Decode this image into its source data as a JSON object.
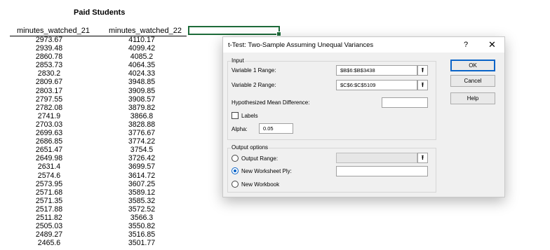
{
  "spreadsheet": {
    "title": "Paid Students",
    "col1_header": "minutes_watched_21",
    "col2_header": "minutes_watched_22",
    "col1_values": [
      "2973.67",
      "2939.48",
      "2860.78",
      "2853.73",
      "2830.2",
      "2809.67",
      "2803.17",
      "2797.55",
      "2782.08",
      "2741.9",
      "2703.03",
      "2699.63",
      "2686.85",
      "2651.47",
      "2649.98",
      "2631.4",
      "2574.6",
      "2573.95",
      "2571.68",
      "2571.35",
      "2517.88",
      "2511.82",
      "2505.03",
      "2489.27",
      "2465.6"
    ],
    "col2_values": [
      "4110.17",
      "4099.42",
      "4085.2",
      "4064.35",
      "4024.33",
      "3948.85",
      "3909.85",
      "3908.57",
      "3879.82",
      "3866.8",
      "3828.88",
      "3776.67",
      "3774.22",
      "3754.5",
      "3726.42",
      "3699.57",
      "3614.72",
      "3607.25",
      "3589.12",
      "3585.32",
      "3572.52",
      "3566.3",
      "3550.82",
      "3516.85",
      "3501.77"
    ]
  },
  "dialog": {
    "title": "t-Test: Two-Sample Assuming Unequal Variances",
    "help_glyph": "?",
    "close_glyph": "✕",
    "input_label": "Input",
    "var1_label": "Variable 1 Range:",
    "var1_value": "$B$6:$B$3438",
    "var2_label": "Variable 2 Range:",
    "var2_value": "$C$6:$C$5109",
    "hyp_label": "Hypothesized Mean Difference:",
    "hyp_value": "",
    "labels_label": "Labels",
    "labels_checked": false,
    "alpha_label": "Alpha:",
    "alpha_value": "0.05",
    "output_options_label": "Output options",
    "output_range_label": "Output Range:",
    "output_range_value": "",
    "new_ply_label": "New Worksheet Ply:",
    "new_ply_value": "",
    "new_workbook_label": "New Workbook",
    "selected_output": "new_worksheet_ply",
    "ok_label": "OK",
    "cancel_label": "Cancel",
    "help_label": "Help",
    "ref_glyph": "⭱"
  }
}
